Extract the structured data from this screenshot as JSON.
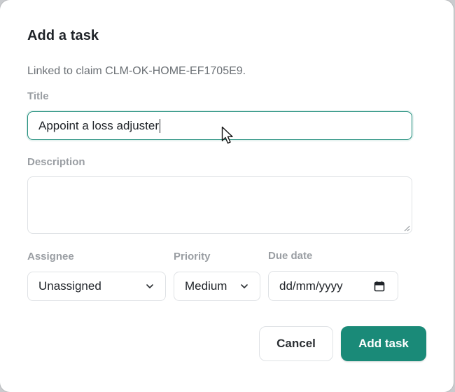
{
  "dialog": {
    "title": "Add a task",
    "subtitle": "Linked to claim CLM-OK-HOME-EF1705E9."
  },
  "fields": {
    "title_label": "Title",
    "title_value": "Appoint a loss adjuster",
    "description_label": "Description",
    "description_value": "",
    "assignee_label": "Assignee",
    "assignee_value": "Unassigned",
    "priority_label": "Priority",
    "priority_value": "Medium",
    "due_label": "Due date",
    "due_placeholder": "dd/mm/yyyy"
  },
  "buttons": {
    "cancel": "Cancel",
    "add": "Add task"
  },
  "icons": {
    "assignee_chevron": "chevron-down-icon",
    "priority_chevron": "chevron-down-icon",
    "calendar": "calendar-icon",
    "cursor": "mouse-pointer-icon"
  },
  "colors": {
    "accent": "#1a8a78",
    "label": "#9a9ea3",
    "text": "#1f2328"
  }
}
